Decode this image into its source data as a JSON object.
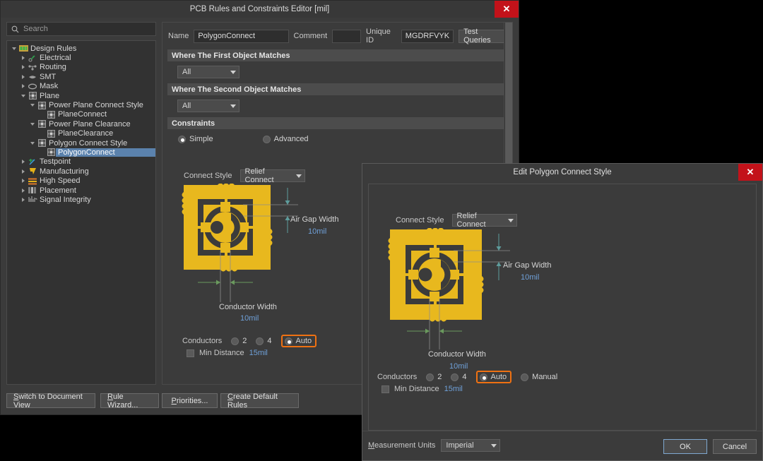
{
  "main_window": {
    "title": "PCB Rules and Constraints Editor [mil]",
    "close_icon": "close-icon",
    "search": {
      "placeholder": "Search",
      "icon": "search-icon"
    },
    "tree": {
      "items": [
        {
          "label": "Design Rules",
          "depth": 0,
          "state": "open",
          "icon": "folder-rules-icon",
          "selected": false
        },
        {
          "label": "Electrical",
          "depth": 1,
          "state": "closed",
          "icon": "electrical-icon",
          "selected": false
        },
        {
          "label": "Routing",
          "depth": 1,
          "state": "closed",
          "icon": "routing-icon",
          "selected": false
        },
        {
          "label": "SMT",
          "depth": 1,
          "state": "closed",
          "icon": "smt-icon",
          "selected": false
        },
        {
          "label": "Mask",
          "depth": 1,
          "state": "closed",
          "icon": "mask-icon",
          "selected": false
        },
        {
          "label": "Plane",
          "depth": 1,
          "state": "open",
          "icon": "plane-icon",
          "selected": false
        },
        {
          "label": "Power Plane Connect Style",
          "depth": 2,
          "state": "open",
          "icon": "plane-icon",
          "selected": false
        },
        {
          "label": "PlaneConnect",
          "depth": 3,
          "state": "leaf",
          "icon": "plane-icon",
          "selected": false
        },
        {
          "label": "Power Plane Clearance",
          "depth": 2,
          "state": "open",
          "icon": "plane-icon",
          "selected": false
        },
        {
          "label": "PlaneClearance",
          "depth": 3,
          "state": "leaf",
          "icon": "plane-icon",
          "selected": false
        },
        {
          "label": "Polygon Connect Style",
          "depth": 2,
          "state": "open",
          "icon": "plane-icon",
          "selected": false
        },
        {
          "label": "PolygonConnect",
          "depth": 3,
          "state": "leaf",
          "icon": "plane-icon",
          "selected": true
        },
        {
          "label": "Testpoint",
          "depth": 1,
          "state": "closed",
          "icon": "testpoint-icon",
          "selected": false
        },
        {
          "label": "Manufacturing",
          "depth": 1,
          "state": "closed",
          "icon": "manufacturing-icon",
          "selected": false
        },
        {
          "label": "High Speed",
          "depth": 1,
          "state": "closed",
          "icon": "highspeed-icon",
          "selected": false
        },
        {
          "label": "Placement",
          "depth": 1,
          "state": "closed",
          "icon": "placement-icon",
          "selected": false
        },
        {
          "label": "Signal Integrity",
          "depth": 1,
          "state": "closed",
          "icon": "signal-icon",
          "selected": false
        }
      ]
    },
    "form": {
      "name_label": "Name",
      "name_value": "PolygonConnect",
      "comment_label": "Comment",
      "comment_value": "",
      "unique_id_label": "Unique ID",
      "unique_id_value": "MGDRFVYK",
      "test_queries_label": "Test Queries",
      "first_object_header": "Where The First Object Matches",
      "first_object_value": "All",
      "second_object_header": "Where The Second Object Matches",
      "second_object_value": "All",
      "constraints_header": "Constraints",
      "simple_label": "Simple",
      "advanced_label": "Advanced",
      "mode_selected": "Simple"
    },
    "connect": {
      "connect_style_label": "Connect Style",
      "connect_style_value": "Relief Connect",
      "air_gap_label": "Air Gap Width",
      "air_gap_value": "10mil",
      "conductor_width_label": "Conductor Width",
      "conductor_width_value": "10mil",
      "conductors_label": "Conductors",
      "conductors_options": [
        "2",
        "4",
        "Auto"
      ],
      "conductors_selected": "Auto",
      "min_distance_label": "Min Distance",
      "min_distance_value": "15mil",
      "min_distance_checked": false
    },
    "bottom_buttons": [
      {
        "label": "Switch to Document View",
        "accel": "S"
      },
      {
        "label": "Rule Wizard...",
        "accel": "R"
      },
      {
        "label": "Priorities...",
        "accel": "P"
      },
      {
        "label": "Create Default Rules",
        "accel": "C"
      }
    ]
  },
  "dialog": {
    "title": "Edit Polygon Connect Style",
    "close_icon": "close-icon",
    "connect": {
      "connect_style_label": "Connect Style",
      "connect_style_value": "Relief Connect",
      "air_gap_label": "Air Gap Width",
      "air_gap_value": "10mil",
      "conductor_width_label": "Conductor Width",
      "conductor_width_value": "10mil",
      "conductors_label": "Conductors",
      "conductors_options": [
        "2",
        "4",
        "Auto",
        "Manual"
      ],
      "conductors_selected": "Auto",
      "min_distance_label": "Min Distance",
      "min_distance_value": "15mil",
      "min_distance_checked": false
    },
    "footer": {
      "measurement_units_label": "Measurement Units",
      "measurement_units_accel": "M",
      "measurement_units_value": "Imperial",
      "ok_label": "OK",
      "cancel_label": "Cancel"
    }
  },
  "colors": {
    "accent_orange": "#ef7112",
    "copper_yellow": "#e8b81e",
    "value_blue": "#6fa0d8",
    "close_red": "#c3121a",
    "selection_blue": "#5b82ad"
  }
}
